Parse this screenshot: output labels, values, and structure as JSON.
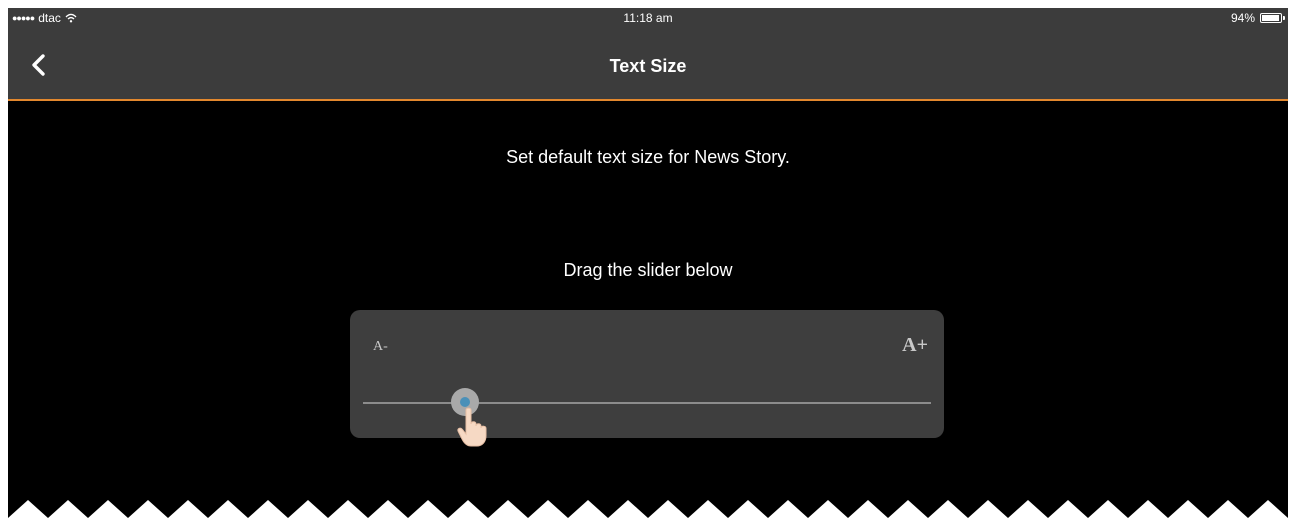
{
  "status_bar": {
    "carrier": "dtac",
    "signal_text": "●●●●●",
    "time": "11:18 am",
    "battery_percent": "94%",
    "battery_level": 0.94,
    "icons": [
      "signal-dots-icon",
      "wifi-icon",
      "battery-icon"
    ]
  },
  "nav": {
    "title": "Text Size",
    "back_icon": "chevron-left-icon",
    "accent_color": "#e3882e"
  },
  "content": {
    "description": "Set default text size for News Story.",
    "instruction": "Drag the slider below"
  },
  "slider": {
    "min_label": "A-",
    "max_label": "A+",
    "value_fraction": 0.18,
    "hint_icon": "hand-pointer-icon"
  },
  "colors": {
    "bar_background": "#3c3c3c",
    "screen_background": "#000000",
    "panel_background": "#3e3e3e",
    "thumb_center": "#4a90b8"
  }
}
